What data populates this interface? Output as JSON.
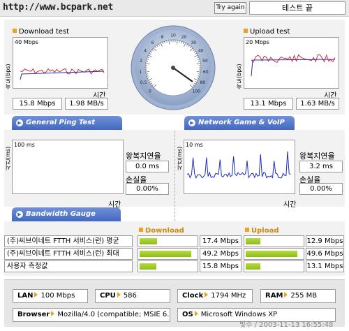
{
  "header": {
    "url": "http://www.bcpark.net",
    "try_again_label": "Try again",
    "result_text": "테스트 끝"
  },
  "download": {
    "title": "Download test",
    "axis_max": "40 Mbps",
    "y_label": "속도(bps)",
    "x_label": "시간",
    "mbps": "15.8 Mbps",
    "mbs": "1.98 MB/s"
  },
  "upload": {
    "title": "Upload test",
    "axis_max": "20 Mbps",
    "y_label": "속도(bps)",
    "x_label": "시간",
    "mbps": "13.1 Mbps",
    "mbs": "1.63 MB/s"
  },
  "gauge": {
    "tick_labels": [
      "0",
      "0.5",
      "1",
      "2",
      "4",
      "6",
      "8",
      "10",
      "20",
      "30",
      "40",
      "50",
      "60",
      "80",
      "100"
    ],
    "needle_value": "15.8"
  },
  "ping": {
    "tab_label": "General Ping Test",
    "axis_max": "100 ms",
    "y_label": "시간(ms)",
    "x_label": "시간",
    "latency_label": "왕복지연율",
    "latency_value": "0.0 ms",
    "loss_label": "손실율",
    "loss_value": "0.00%"
  },
  "game": {
    "tab_label": "Network Game & VoIP Test",
    "axis_max": "10 ms",
    "y_label": "시간(ms)",
    "x_label": "시간",
    "latency_label": "왕복지연율",
    "latency_value": "3.2 ms",
    "loss_label": "손실율",
    "loss_value": "0.00%"
  },
  "bandwidth": {
    "tab_label": "Bandwidth Gauge",
    "download_header": "Download",
    "upload_header": "Upload",
    "rows": [
      {
        "label": "(주)씨브이네트 FTTH 서비스(런) 평균",
        "dl": "17.4 Mbps",
        "dl_fill": 0.31,
        "ul": "12.9 Mbps",
        "ul_fill": 0.26
      },
      {
        "label": "(주)씨브이네트 FTTH 서비스(런) 최대",
        "dl": "49.2 Mbps",
        "dl_fill": 0.9,
        "ul": "49.6 Mbps",
        "ul_fill": 0.9
      },
      {
        "label": "사용자 측정값",
        "dl": "15.8 Mbps",
        "dl_fill": 0.29,
        "ul": "13.1 Mbps",
        "ul_fill": 0.25
      }
    ]
  },
  "sysinfo": {
    "lan_label": "LAN",
    "lan_value": "100 Mbps",
    "cpu_label": "CPU",
    "cpu_value": "586",
    "clock_label": "Clock",
    "clock_value": "1794 MHz",
    "ram_label": "RAM",
    "ram_value": "255 MB",
    "browser_label": "Browser",
    "browser_value": "Mozilla/4.0 (compatible; MSIE 6.0",
    "os_label": "OS",
    "os_value": "Microsoft Windows XP"
  },
  "footer": {
    "stamp": "빛주 / 2003-11-13 16:55:48"
  },
  "colors": {
    "tab_blue": "#4368bf",
    "accent_orange": "#f0a020",
    "bar_green": "#9acb24",
    "line_red": "#e03030",
    "line_blue": "#2030c0"
  }
}
